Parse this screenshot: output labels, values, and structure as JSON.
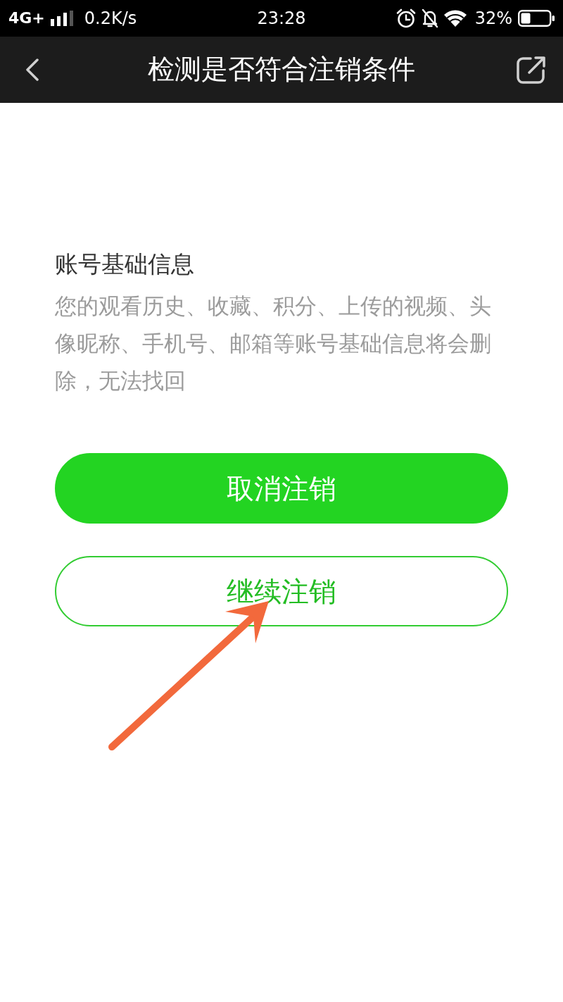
{
  "status_bar": {
    "network": "4G+",
    "speed": "0.2K/s",
    "time": "23:28",
    "battery": "32%"
  },
  "nav_bar": {
    "title": "检测是否符合注销条件"
  },
  "section": {
    "heading": "账号基础信息",
    "description": "您的观看历史、收藏、积分、上传的视频、头像昵称、手机号、邮箱等账号基础信息将会删除，无法找回"
  },
  "buttons": [
    {
      "label": "取消注销",
      "kind": "primary"
    },
    {
      "label": "继续注销",
      "kind": "outline"
    }
  ],
  "annotations": [
    {
      "kind": "arrow"
    }
  ]
}
